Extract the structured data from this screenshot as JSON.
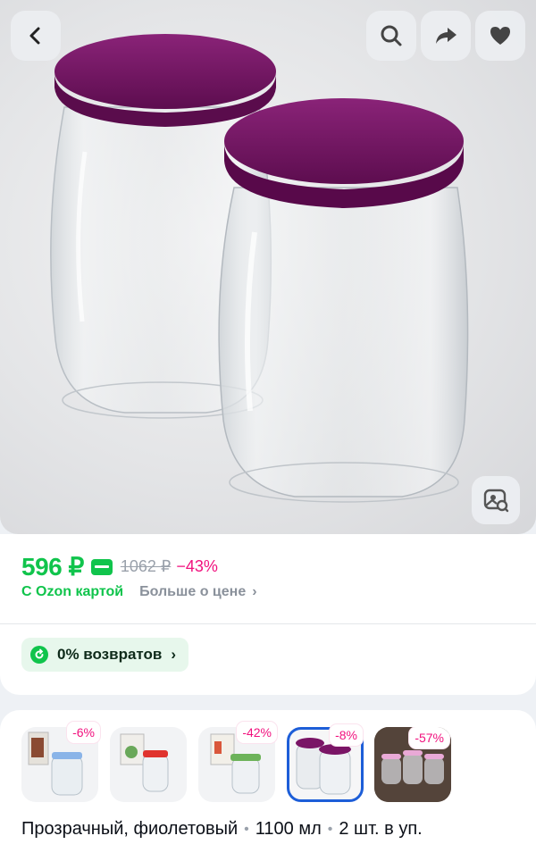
{
  "price": {
    "current": "596 ₽",
    "old": "1062 ₽",
    "discount": "−43%",
    "ozon_card_label": "С Ozon картой",
    "more_link": "Больше о цене"
  },
  "returns": {
    "label": "0% возвратов"
  },
  "variants": [
    {
      "discount": "-6%",
      "lid_color": "#8ab4e8"
    },
    {
      "discount": "",
      "lid_color": "#e0332e"
    },
    {
      "discount": "-42%",
      "lid_color": "#6db35a"
    },
    {
      "discount": "-8%",
      "lid_color": "#7a1566",
      "selected": true
    },
    {
      "discount": "-57%",
      "lid_color": "#e9a9d6"
    }
  ],
  "variant_description": {
    "color": "Прозрачный, фиолетовый",
    "volume": "1100 мл",
    "pack": "2 шт. в уп."
  },
  "icons": [
    "back-icon",
    "search-icon",
    "share-icon",
    "heart-icon",
    "image-search-icon",
    "card-icon",
    "returns-icon"
  ],
  "colors": {
    "accent_green": "#10c44c",
    "discount_pink": "#f1117e",
    "selected_blue": "#1d5ed8",
    "lid_purple": "#7a1566"
  }
}
